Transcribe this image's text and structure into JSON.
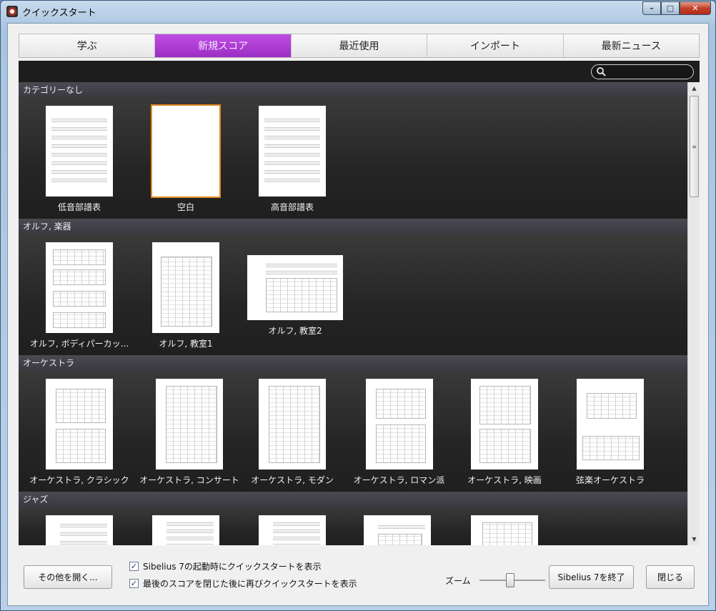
{
  "window": {
    "title": "クイックスタート"
  },
  "tabs": [
    "学ぶ",
    "新規スコア",
    "最近使用",
    "インポート",
    "最新ニュース"
  ],
  "active_tab": "新規スコア",
  "categories": [
    {
      "name": "カテゴリーなし",
      "items": [
        "低音部譜表",
        "空白",
        "高音部譜表"
      ]
    },
    {
      "name": "オルフ, 楽器",
      "items": [
        "オルフ, ボディパーカッ...",
        "オルフ, 教室1",
        "オルフ, 教室2"
      ]
    },
    {
      "name": "オーケストラ",
      "items": [
        "オーケストラ, クラシック",
        "オーケストラ, コンサート",
        "オーケストラ, モダン",
        "オーケストラ, ロマン派",
        "オーケストラ, 映画",
        "弦楽オーケストラ"
      ]
    },
    {
      "name": "ジャズ",
      "items": []
    }
  ],
  "bottom": {
    "open_other_button": "その他を開く...",
    "show_on_startup": "Sibelius 7の起動時にクイックスタートを表示",
    "show_after_close": "最後のスコアを閉じた後に再びクイックスタートを表示",
    "zoom_label": "ズーム",
    "exit_button": "Sibelius 7を終了",
    "close_button": "閉じる"
  },
  "colors": {
    "active_tab": "#a83ad0",
    "selected_outline": "#e08a20",
    "panel_bg": "#232323"
  }
}
